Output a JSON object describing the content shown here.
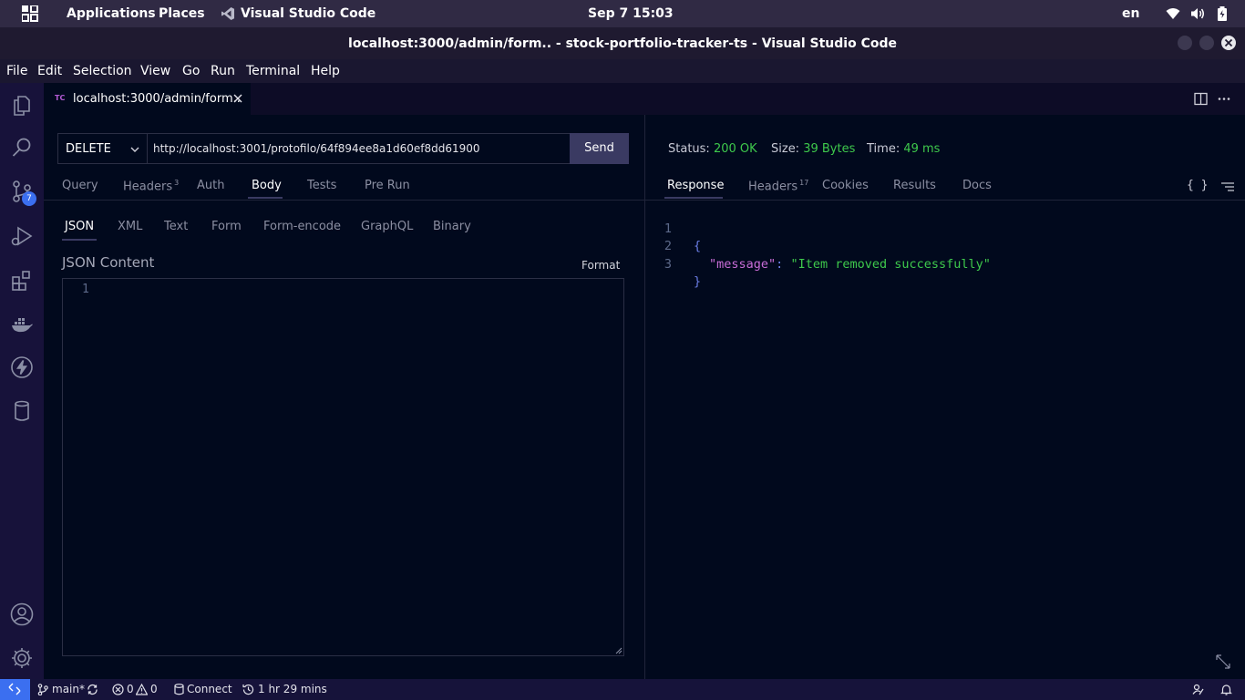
{
  "gnome": {
    "applications": "Applications",
    "places": "Places",
    "active_app": "Visual Studio Code",
    "datetime": "Sep 7  15:03",
    "keyboard_layout": "en"
  },
  "window": {
    "title": "localhost:3000/admin/form.. - stock-portfolio-tracker-ts - Visual Studio Code"
  },
  "menu": [
    "File",
    "Edit",
    "Selection",
    "View",
    "Go",
    "Run",
    "Terminal",
    "Help"
  ],
  "activity_bar": {
    "icons": [
      "explorer-icon",
      "search-icon",
      "source-control-icon",
      "run-debug-icon",
      "extensions-icon",
      "docker-icon",
      "thunder-client-icon",
      "database-icon",
      "account-icon",
      "settings-gear-icon"
    ],
    "source_control_badge": "7"
  },
  "editor_tab": {
    "icon_text": "TC",
    "label": "localhost:3000/admin/form.."
  },
  "request": {
    "method": "DELETE",
    "url": "http://localhost:3001/protofilo/64f894ee8a1d60ef8dd61900",
    "send_label": "Send",
    "tabs": [
      {
        "label": "Query"
      },
      {
        "label": "Headers",
        "count": "3"
      },
      {
        "label": "Auth"
      },
      {
        "label": "Body",
        "active": true
      },
      {
        "label": "Tests"
      },
      {
        "label": "Pre Run"
      }
    ],
    "body_tabs": [
      "JSON",
      "XML",
      "Text",
      "Form",
      "Form-encode",
      "GraphQL",
      "Binary"
    ],
    "active_body_tab": "JSON",
    "json_label": "JSON Content",
    "format_label": "Format",
    "editor_line": "1"
  },
  "response": {
    "status_label": "Status:",
    "status_value": "200 OK",
    "size_label": "Size:",
    "size_value": "39 Bytes",
    "time_label": "Time:",
    "time_value": "49 ms",
    "tabs": [
      {
        "label": "Response",
        "active": true
      },
      {
        "label": "Headers",
        "count": "17"
      },
      {
        "label": "Cookies"
      },
      {
        "label": "Results"
      },
      {
        "label": "Docs"
      }
    ],
    "body_lines": [
      {
        "n": "1",
        "open": "{"
      },
      {
        "n": "2",
        "key": "\"message\"",
        "colon": ":",
        "value": "\"Item removed successfully\""
      },
      {
        "n": "3",
        "close": "}"
      }
    ],
    "braces_label": "{ }"
  },
  "status_bar": {
    "branch": "main*",
    "errors": "0",
    "warnings": "0",
    "connect": "Connect",
    "time_tracked": "1 hr 29 mins"
  },
  "colors": {
    "accent_blue": "#3b6ff0",
    "success_green": "#3ec94c",
    "json_key": "#c86dd7",
    "editor_bg": "#01091d"
  }
}
